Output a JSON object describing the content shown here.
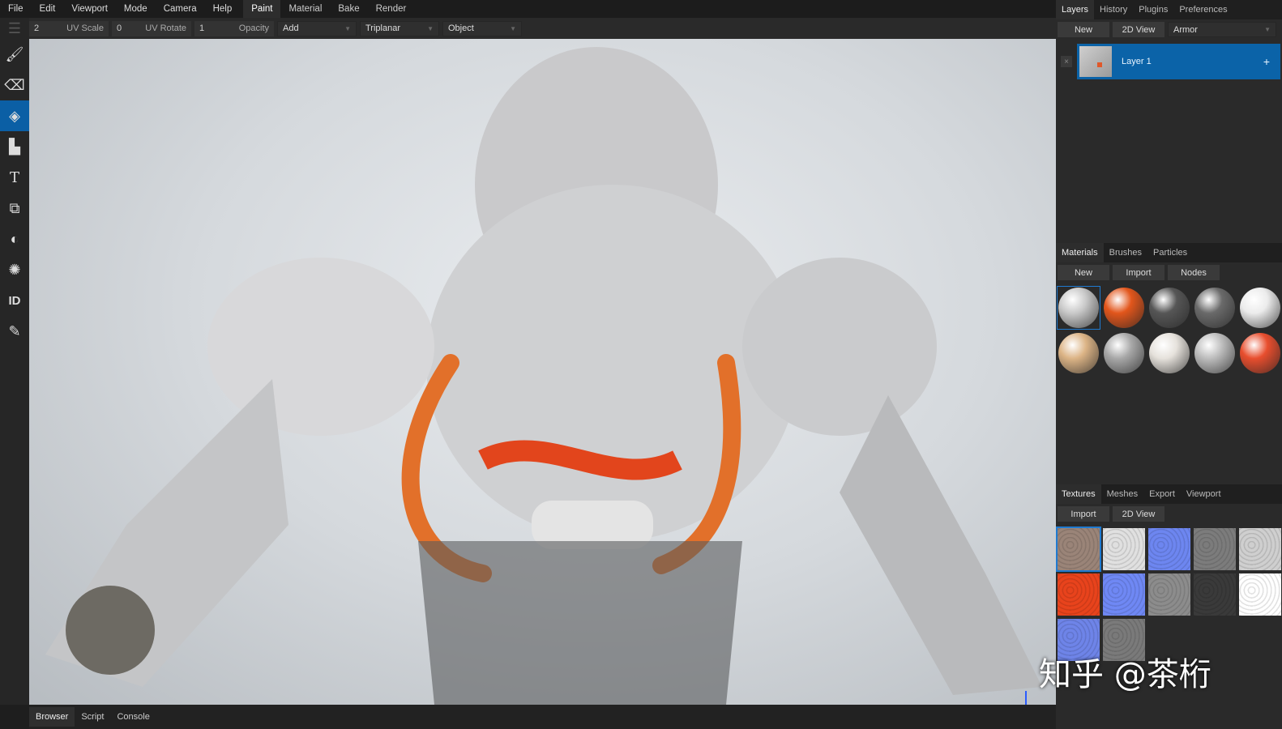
{
  "menu": [
    "File",
    "Edit",
    "Viewport",
    "Mode",
    "Camera",
    "Help"
  ],
  "workspaces": [
    {
      "label": "Paint",
      "active": true
    },
    {
      "label": "Material"
    },
    {
      "label": "Bake"
    },
    {
      "label": "Render"
    }
  ],
  "tool_options": {
    "uv_scale": {
      "value": "2",
      "label": "UV Scale"
    },
    "uv_rotate": {
      "value": "0",
      "label": "UV Rotate"
    },
    "opacity": {
      "value": "1",
      "label": "Opacity"
    },
    "blend": "Add",
    "mapping": "Triplanar",
    "target": "Object"
  },
  "tools": [
    "brush-icon",
    "eraser-icon",
    "fill-icon",
    "decal-icon",
    "text-icon",
    "clone-icon",
    "blur-icon",
    "particle-icon",
    "id-picker-icon",
    "color-picker-icon"
  ],
  "layers_panel": {
    "tabs": [
      "Layers",
      "History",
      "Plugins",
      "Preferences"
    ],
    "new": "New",
    "view2d": "2D View",
    "object": "Armor",
    "layers": [
      {
        "name": "Layer 1",
        "add": "+",
        "remove": "×"
      }
    ]
  },
  "materials_panel": {
    "tabs": [
      "Materials",
      "Brushes",
      "Particles"
    ],
    "new": "New",
    "import": "Import",
    "nodes": "Nodes",
    "materials": [
      "#c9c9c9",
      "#e2561c",
      "#565656",
      "#6a6a6a",
      "#ececec",
      "#dcb486",
      "#a8a8a8",
      "#e6e2dc",
      "#bdbdbd",
      "#e84e2e"
    ]
  },
  "textures_panel": {
    "tabs": [
      "Textures",
      "Meshes",
      "Export",
      "Viewport"
    ],
    "import": "Import",
    "view2d": "2D View",
    "textures": [
      "#9a8478",
      "#e0e0e0",
      "#6d86f0",
      "#7c7c7c",
      "#cfcfcf",
      "#e8431c",
      "#6f88f4",
      "#8c8c8c",
      "#3a3a3a",
      "#ffffff",
      "#6e84e8",
      "#7a7a7a"
    ]
  },
  "bottom_tabs": [
    "Browser",
    "Script",
    "Console"
  ],
  "watermark": "知乎 @茶桁"
}
